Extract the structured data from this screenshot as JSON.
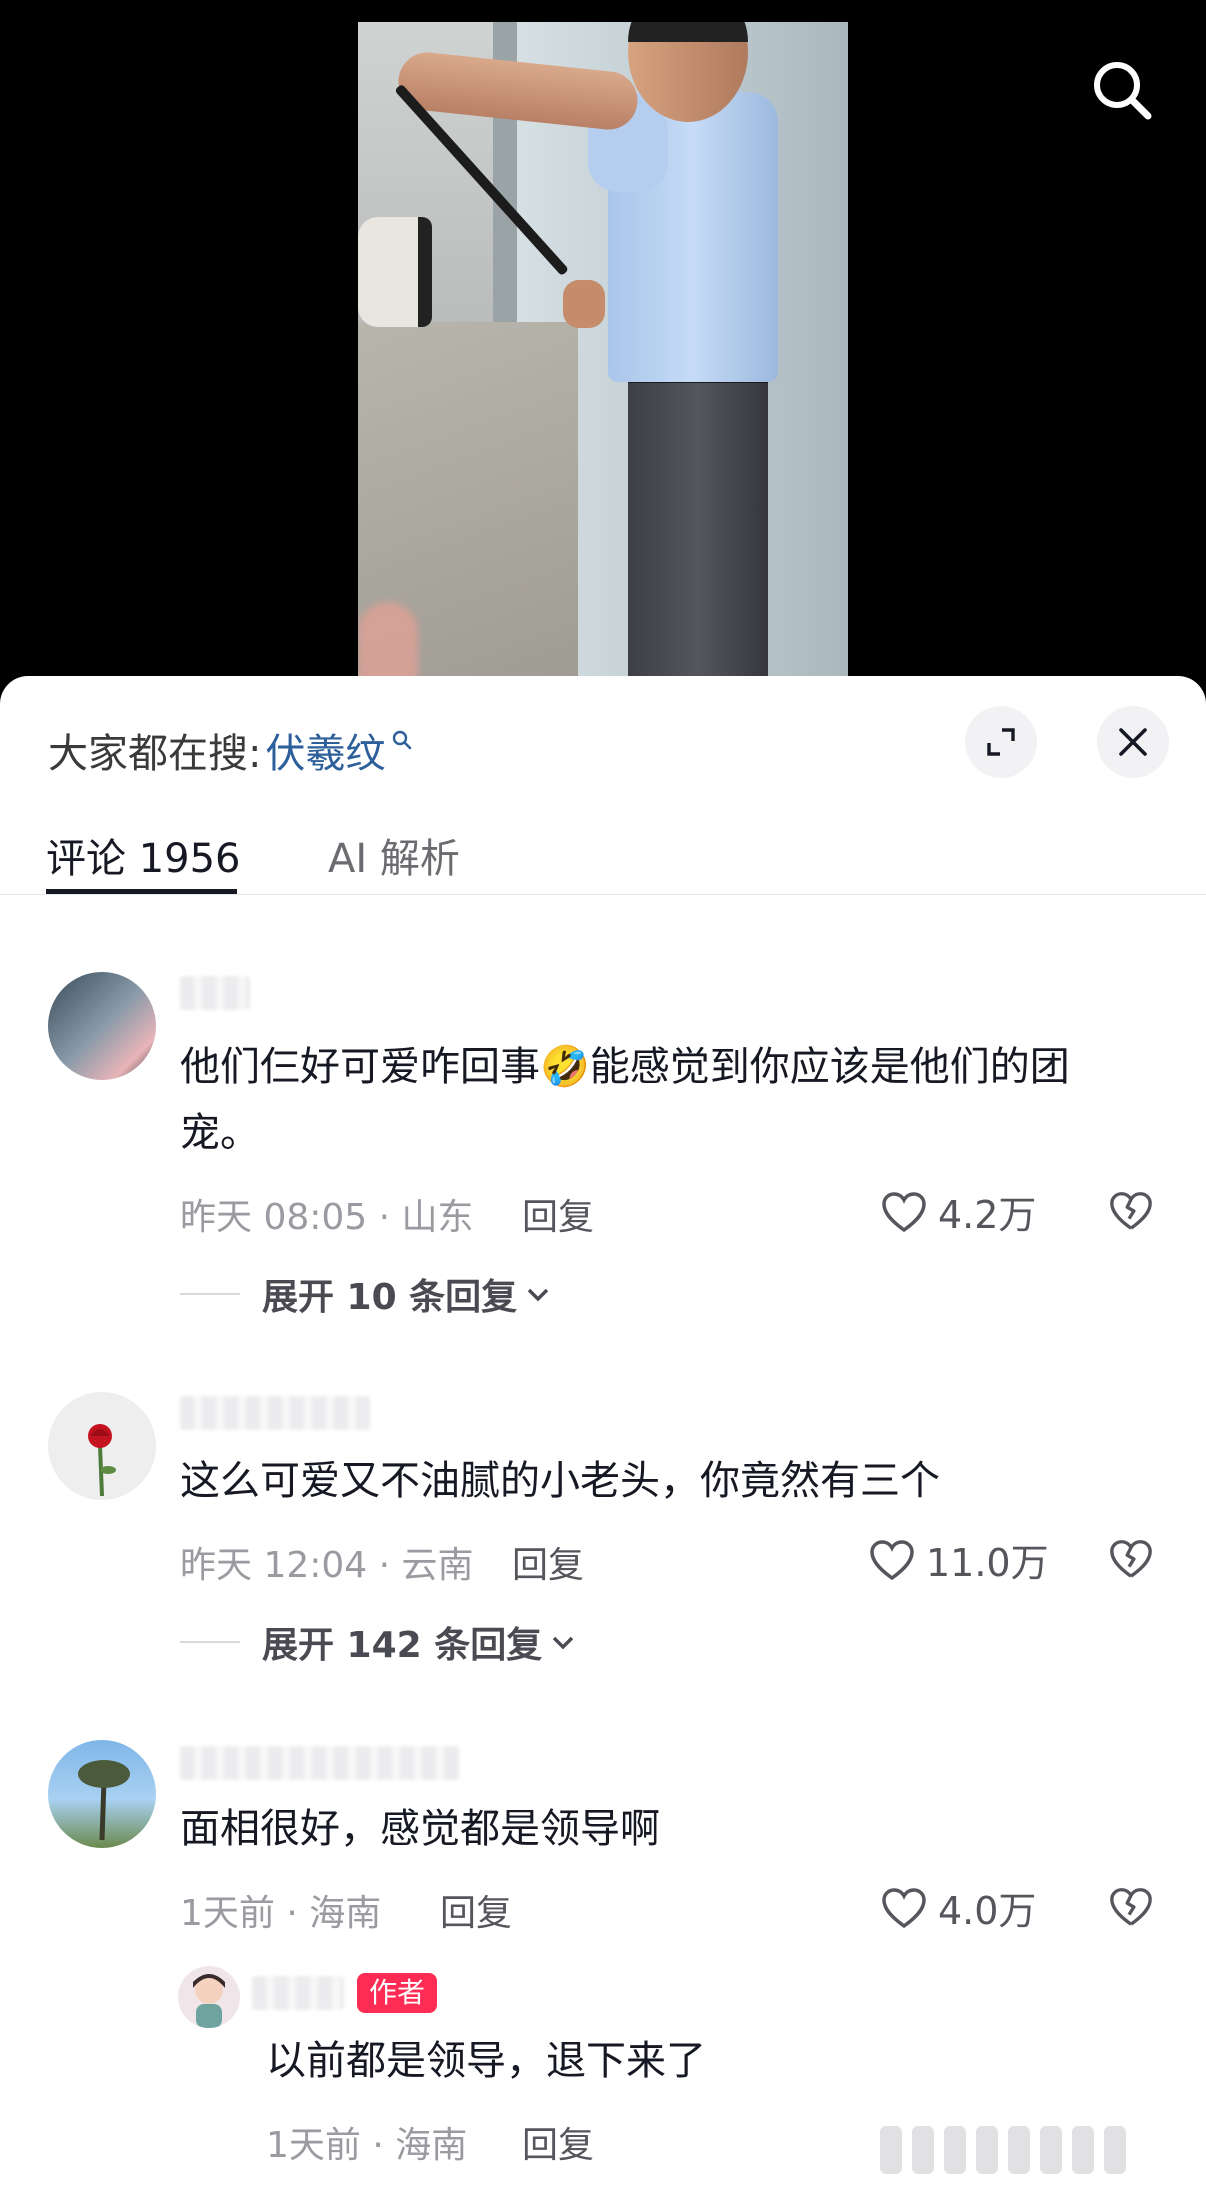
{
  "search_hint": {
    "prefix": "大家都在搜:",
    "term": "伏羲纹"
  },
  "tabs": [
    {
      "label": "评论 1956",
      "active": true
    },
    {
      "label": "AI 解析",
      "active": false
    }
  ],
  "comments": [
    {
      "text": "他们仨好可爱咋回事🤣能感觉到你应该是他们的团宠。",
      "meta": "昨天 08:05 · 山东",
      "reply_label": "回复",
      "likes": "4.2万",
      "expand_label": "展开 10 条回复"
    },
    {
      "text": "这么可爱又不油腻的小老头，你竟然有三个",
      "meta": "昨天 12:04 · 云南",
      "reply_label": "回复",
      "likes": "11.0万",
      "expand_label": "展开 142 条回复"
    },
    {
      "text": "面相很好，感觉都是领导啊",
      "meta": "1天前 · 海南",
      "reply_label": "回复",
      "likes": "4.0万"
    }
  ],
  "sub_reply": {
    "badge": "作者",
    "text": "以前都是领导，退下来了",
    "meta": "1天前 · 海南",
    "reply_label": "回复"
  },
  "colors": {
    "accent_link": "#2d5f9a",
    "author_badge": "#fe2c55",
    "sheet_bg": "#ffffff",
    "video_bg": "#000000"
  },
  "icons": [
    "search-icon",
    "expand-icon",
    "close-icon",
    "heart-icon",
    "broken-heart-icon",
    "chevron-down-icon"
  ]
}
